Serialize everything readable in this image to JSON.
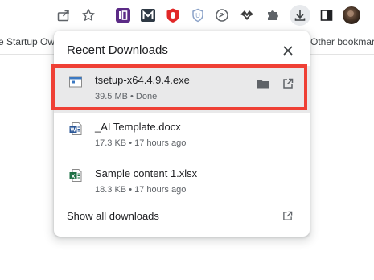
{
  "bookmarks": {
    "left_partial": "e Startup Ow",
    "right_partial": "Other bookmar"
  },
  "toolbar": {
    "icons": [
      "share-icon",
      "star-icon",
      "extension-purple-icon",
      "extension-m-icon",
      "extension-red-icon",
      "extension-shield-icon",
      "extension-circle-icon",
      "extension-bird-icon",
      "puzzle-icon",
      "download-icon",
      "side-panel-icon",
      "profile-avatar"
    ]
  },
  "downloads": {
    "title": "Recent Downloads",
    "show_all_label": "Show all downloads",
    "items": [
      {
        "name": "tsetup-x64.4.9.4.exe",
        "meta": "39.5 MB • Done",
        "icon": "exe-file-icon"
      },
      {
        "name": "_AI Template.docx",
        "meta": "17.3 KB • 17 hours ago",
        "icon": "word-file-icon"
      },
      {
        "name": "Sample content 1.xlsx",
        "meta": "18.3 KB • 17 hours ago",
        "icon": "excel-file-icon"
      }
    ]
  },
  "colors": {
    "highlight": "#ef4035",
    "hover_row": "#e9e9ea",
    "word_blue": "#2b5797",
    "excel_green": "#1e7145"
  }
}
